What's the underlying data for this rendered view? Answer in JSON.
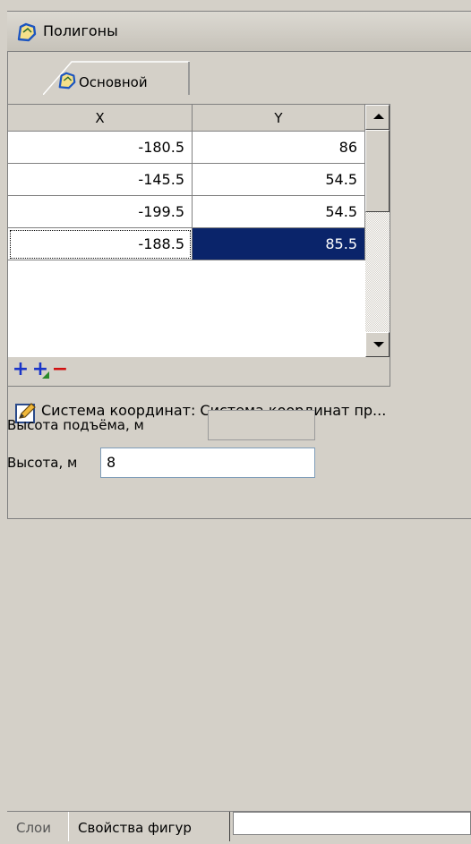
{
  "header": {
    "title": "Полигоны",
    "icon": "polygon-icon"
  },
  "tab": {
    "label": "Основной",
    "icon": "polygon-icon"
  },
  "grid": {
    "columns": [
      "X",
      "Y"
    ],
    "rows": [
      {
        "x": "-180.5",
        "y": "86"
      },
      {
        "x": "-145.5",
        "y": "54.5"
      },
      {
        "x": "-199.5",
        "y": "54.5"
      },
      {
        "x": "-188.5",
        "y": "85.5"
      }
    ],
    "toolbar": {
      "add": "+",
      "insert": "+",
      "remove": "−"
    }
  },
  "properties": {
    "coord_system_label": "Система координат: Система координат пр...",
    "lift_height_label": "Высота подъёма, м",
    "lift_height_value": "",
    "height_label": "Высота, м",
    "height_value": "8"
  },
  "bottom_tabs": {
    "layers": "Слои",
    "shape_props": "Свойства фигур"
  },
  "colors": {
    "selection": "#0a246a",
    "add_icon": "#1a35c8",
    "remove_icon": "#d01010",
    "background": "#d4d0c8"
  }
}
